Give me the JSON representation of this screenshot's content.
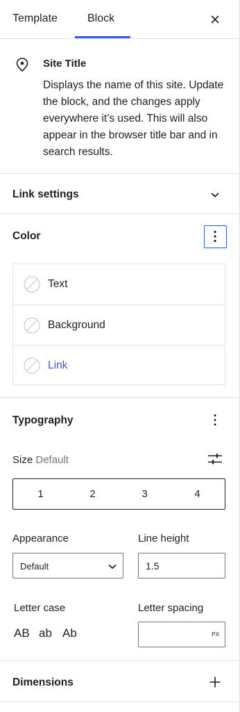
{
  "tabs": {
    "template": "Template",
    "block": "Block"
  },
  "block": {
    "title": "Site Title",
    "description": "Displays the name of this site. Update the block, and the changes apply everywhere it’s used. This will also appear in the browser title bar and in search results."
  },
  "link_settings": {
    "title": "Link settings"
  },
  "color": {
    "title": "Color",
    "items": [
      {
        "label": "Text"
      },
      {
        "label": "Background"
      },
      {
        "label": "Link"
      }
    ],
    "accent": "#3858e9"
  },
  "typography": {
    "title": "Typography",
    "size_label": "Size",
    "size_value": "Default",
    "size_options": [
      "1",
      "2",
      "3",
      "4"
    ],
    "appearance_label": "Appearance",
    "appearance_value": "Default",
    "line_height_label": "Line height",
    "line_height_value": "1.5",
    "letter_case_label": "Letter case",
    "letter_case_options": [
      "AB",
      "ab",
      "Ab"
    ],
    "letter_spacing_label": "Letter spacing",
    "letter_spacing_value": "",
    "letter_spacing_unit": "PX"
  },
  "dimensions": {
    "title": "Dimensions"
  },
  "icons": [
    "close-icon",
    "location-pin-icon",
    "chevron-down-icon",
    "more-vertical-icon",
    "no-color-icon",
    "sliders-icon",
    "plus-icon"
  ]
}
